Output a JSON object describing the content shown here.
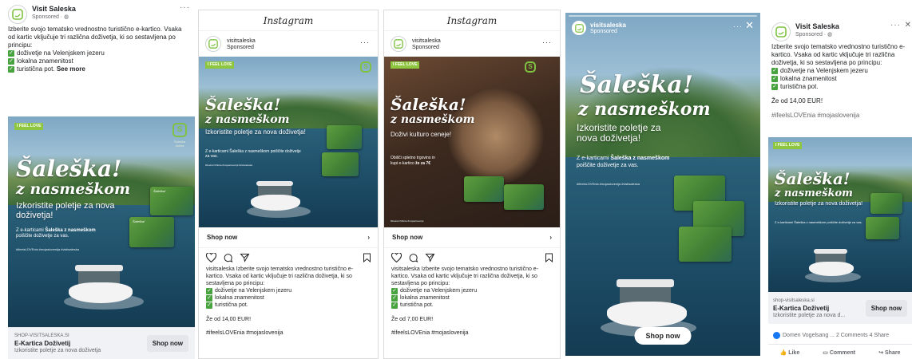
{
  "facebook_feed": {
    "page_name": "Visit Saleska",
    "sponsored": "Sponsored · ",
    "more": "···",
    "intro": "Izberite svojo tematsko vrednostno turistično e-kartico. Vsaka od kartic vključuje tri različna doživetja, ki so sestavljena po principu:",
    "items": [
      "doživetje na Velenjskem jezeru",
      "lokalna znamenitost",
      "turistična pot.",
      "See more"
    ],
    "creative": {
      "ifeel": "I FEEL LOVE",
      "brand_caption": "Šaleška dolina",
      "headline_1": "Šaleška!",
      "headline_2": "z nasmeškom",
      "sub": "Izkoristite poletje za nova doživetja!",
      "small_1": "Z e-karticami ",
      "small_bold": "Šaleška z nasmeškom",
      "small_2": "poiščite doživetje za vas.",
      "tags": "#ifeelsLOVEnia #mojaslovenija #visitsaleska"
    },
    "link": {
      "site": "SHOP-VISITSALESKA.SI",
      "title": "E-Kartica Doživetij",
      "desc": "Izkoristite poletje za nova doživetja",
      "button": "Shop now"
    }
  },
  "instagram_1": {
    "app_title": "Instagram",
    "user": "visitsaleska",
    "sponsored": "Sponsored",
    "more": "···",
    "creative": {
      "headline_1": "Šaleška!",
      "headline_2": "z nasmeškom",
      "sub": "Izkoristite poletje za nova doživetja!",
      "small": "Z e-karticami Šaleška z nasmeškom poiščite doživetje za vas.",
      "tags": "#ifeelsLOVEnia #mojaslovenija #visitsaleska"
    },
    "shop_label": "Shop now",
    "caption_user": "visitsaleska",
    "caption": " Izberite svojo tematsko vrednostno turistično e-kartico. Vsaka od kartic vključuje tri različna doživetja, ki so sestavljena po principu:",
    "items": [
      "doživetje na Velenjskem jezeru",
      "lokalna znamenitost",
      "turistična pot."
    ],
    "price": "Že od 14,00 EUR!",
    "tags": "#ifeelsLOVEnia #mojaslovenija"
  },
  "instagram_2": {
    "app_title": "Instagram",
    "user": "visitsaleska",
    "sponsored": "Sponsored",
    "more": "···",
    "creative": {
      "headline_1": "Šaleška!",
      "headline_2": "z nasmeškom",
      "sub": "Doživi kulturo ceneje!",
      "small_1": "Obišči spletno trgovino in",
      "small_2": "kupi e-kartico ",
      "small_bold": "že za 7€",
      "tags": "#ifeelsLOVEnia #mojaslovenija"
    },
    "shop_label": "Shop now",
    "caption_user": "visitsaleska",
    "caption": " Izberite svojo tematsko vrednostno turistično e-kartico. Vsaka od kartic vključuje tri različna doživetja, ki so sestavljena po principu:",
    "items": [
      "doživetje na Velenjskem jezeru",
      "lokalna znamenitost",
      "turistična pot."
    ],
    "price": "Že od 7,00 EUR!",
    "tags": "#ifeelsLOVEnia #mojaslovenija"
  },
  "story": {
    "user": "visitsaleska",
    "sponsored": "Sponsored",
    "more": "···",
    "close": "✕",
    "headline_1": "Šaleška!",
    "headline_2": "z nasmeškom",
    "sub_1": "Izkoristite poletje za",
    "sub_2": "nova doživetja!",
    "small_1": "Z e-karticami ",
    "small_bold": "Šaleška z nasmeškom",
    "small_2": "poiščite doživetje za vas.",
    "tags": "#ifeelsLOVEnia #mojaslovenija #visitsaleska",
    "button": "Shop now"
  },
  "facebook_right": {
    "page_name": "Visit Saleska",
    "sponsored": "Sponsored · ",
    "more": "···",
    "close": "✕",
    "intro": "Izberite svojo tematsko vrednostno turistično e-kartico. Vsaka od kartic vključuje tri različna doživetja, ki so sestavljena po principu:",
    "items": [
      "doživetje na Velenjskem jezeru",
      "lokalna znamenitost",
      "turistična pot."
    ],
    "price": "Že od 14,00 EUR!",
    "tags": "#ifeelsLOVEnia #mojaslovenija",
    "creative": {
      "headline_1": "Šaleška!",
      "headline_2": "z nasmeškom",
      "sub": "Izkoristite poletje za nova doživetja!",
      "small": "Z e-karticami Šaleška z nasmeškom poiščite doživetje za vas."
    },
    "link": {
      "site": "shop-visitsaleska.si",
      "title": "E-Kartica Doživetij",
      "desc": "Izkoristite poletje za nova d...",
      "button": "Shop now"
    },
    "stats": {
      "names": "Domen Vogelsang ...",
      "comments": "2 Comments",
      "shares": "4 Share"
    },
    "actions": [
      "Like",
      "Comment",
      "Share"
    ]
  },
  "colors": {
    "brand_green": "#7fc241",
    "check_green": "#48a23f",
    "fb_blue": "#1877f2"
  }
}
